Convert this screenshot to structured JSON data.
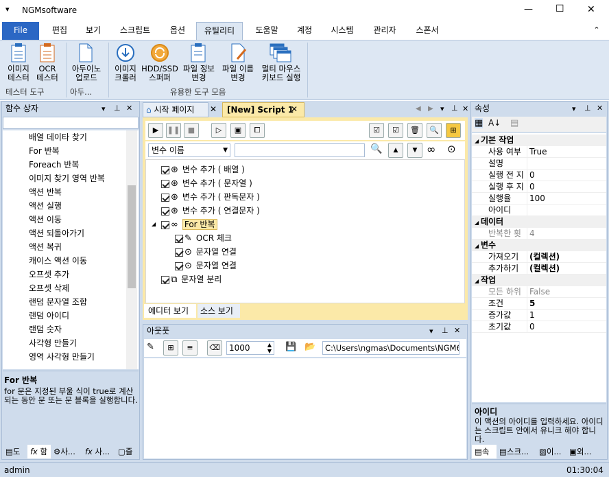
{
  "app": {
    "title": "NGMsoftware",
    "min": "—",
    "max": "☐",
    "close": "✕",
    "quick": "▾"
  },
  "ribbon_tabs": [
    "File",
    "편집",
    "보기",
    "스크립트",
    "옵션",
    "유틸리티",
    "도움말",
    "계정",
    "시스템",
    "관리자",
    "스폰서"
  ],
  "ribbon_collapse": "⌃",
  "ribbon": {
    "btn_img": [
      "이미지",
      "테스터"
    ],
    "btn_ocr": [
      "OCR",
      "테스터"
    ],
    "btn_arduino": [
      "아두이노",
      "업로드"
    ],
    "btn_crawler": [
      "이미지",
      "크롤러"
    ],
    "btn_hdd": [
      "HDD/SSD",
      "스퍼퍼"
    ],
    "btn_fileinfo": [
      "파일 정보",
      "변경"
    ],
    "btn_filename": [
      "파일 이름",
      "변경"
    ],
    "btn_multi": [
      "멀티 마우스",
      "키보드 실행"
    ],
    "grp_tester": "테스터 도구",
    "grp_arduino": "아두...",
    "grp_util": "유용한 도구 모음"
  },
  "left_panel": {
    "title": "함수 상자",
    "items": [
      {
        "icon": "🔍",
        "label": "배열 데이타 찾기"
      },
      {
        "icon": "fx",
        "label": "For 반복"
      },
      {
        "icon": "∞",
        "label": "Foreach 반복"
      },
      {
        "icon": "▦",
        "label": "이미지 찾기 영역 반복"
      },
      {
        "icon": "⊙",
        "label": "액션 반복"
      },
      {
        "icon": "⊕",
        "label": "액션 실행"
      },
      {
        "icon": "↰",
        "label": "액션 이동"
      },
      {
        "icon": "△",
        "label": "액션 되돌아가기"
      },
      {
        "icon": "↻",
        "label": "액션 복귀"
      },
      {
        "icon": "⋔",
        "label": "캐이스 액션 이동"
      },
      {
        "icon": "⧉",
        "label": "오프셋 추가"
      },
      {
        "icon": "⧈",
        "label": "오프셋 삭제"
      },
      {
        "icon": "⊛",
        "label": "랜덤 문자열 조합"
      },
      {
        "icon": "◉",
        "label": "랜덤 아이디"
      },
      {
        "icon": "●",
        "label": "랜덤 숫자"
      },
      {
        "icon": "□",
        "label": "사각형 만들기"
      },
      {
        "icon": "⤡",
        "label": "영역 사각형 만들기"
      }
    ],
    "desc_title": "For 반복",
    "desc_text": "for 문은 지정된 부울 식이 true로 계산되는 동안 문 또는 문 블록을 실행합니다.",
    "bottom_tabs": [
      "도",
      "함",
      "사...",
      "사...",
      "즐"
    ]
  },
  "doc_tabs": {
    "start": "시작 페이지",
    "script": "[New] Script 1"
  },
  "editor": {
    "dropdown": "변수 이름",
    "search": "",
    "tree": [
      {
        "label": "변수 추가 ( 배열 )",
        "indent": 0
      },
      {
        "label": "변수 추가 ( 문자열 )",
        "indent": 0
      },
      {
        "label": "변수 추가 ( 판독문자 )",
        "indent": 0
      },
      {
        "label": "변수 추가 ( 연결문자 )",
        "indent": 0
      },
      {
        "label": "For 반복",
        "indent": 0,
        "selected": true
      },
      {
        "label": "OCR 체크",
        "indent": 1
      },
      {
        "label": "문자열 연결",
        "indent": 1
      },
      {
        "label": "문자열 연결",
        "indent": 1
      },
      {
        "label": "문자열 분리",
        "indent": 0
      }
    ],
    "view_tabs": [
      "에디터 보기",
      "소스 보기"
    ]
  },
  "output": {
    "title": "아웃풋",
    "count": "1000",
    "path": "C:\\Users\\ngmas\\Documents\\NGM6\\"
  },
  "props": {
    "title": "속성",
    "sections": [
      {
        "name": "기본 작업",
        "rows": [
          [
            "사용 여부",
            "True"
          ],
          [
            "설명",
            ""
          ],
          [
            "실행 전 지",
            "0"
          ],
          [
            "실행 후 지",
            "0"
          ],
          [
            "실행율",
            "100"
          ],
          [
            "아이디",
            ""
          ]
        ]
      },
      {
        "name": "데이터",
        "rows": [
          [
            "반복한 횟",
            "4"
          ]
        ]
      },
      {
        "name": "변수",
        "rows": [
          [
            "가져오기",
            "(컬렉션)"
          ],
          [
            "추가하기",
            "(컬렉션)"
          ]
        ]
      },
      {
        "name": "작업",
        "rows": [
          [
            "모든 하위",
            "False"
          ],
          [
            "조건",
            "5"
          ],
          [
            "증가값",
            "1"
          ],
          [
            "초기값",
            "0"
          ]
        ]
      }
    ],
    "desc_title": "아이디",
    "desc_text": "이 액션의 아이디를 입력하세요. 아이디는 스크립트 안에서 유니크 해야 합니다.",
    "bottom_tabs": [
      "속",
      "스크...",
      "이...",
      "외..."
    ]
  },
  "status": {
    "user": "admin",
    "time": "01:30:04"
  }
}
